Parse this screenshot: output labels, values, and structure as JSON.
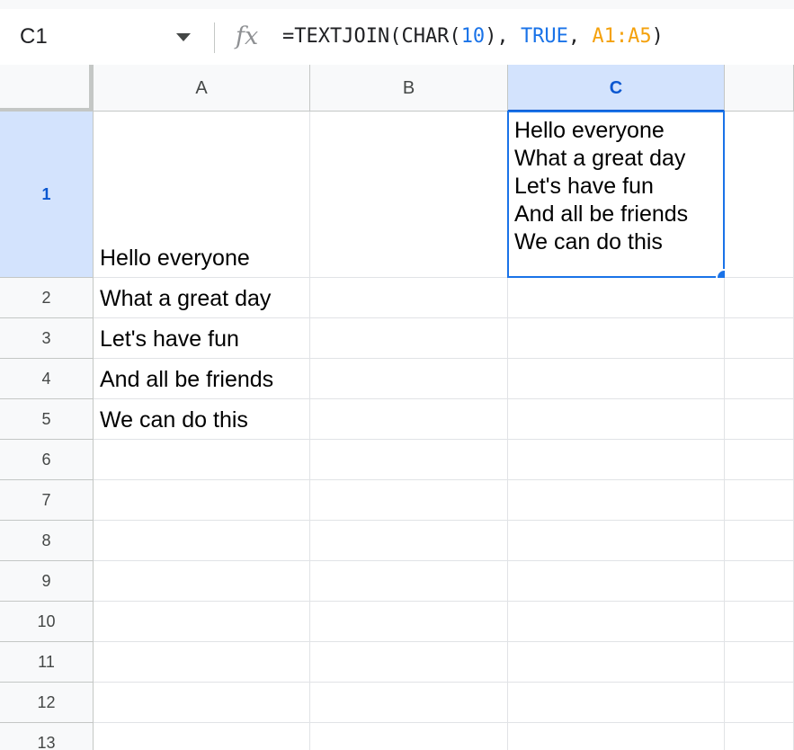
{
  "formula_bar": {
    "name_box": "C1",
    "fx_label": "fx",
    "formula_parts": {
      "fn": "=TEXTJOIN(CHAR(",
      "num": "10",
      "sep1": "), ",
      "bool": "TRUE",
      "sep2": ", ",
      "ref": "A1:A5",
      "end": ")"
    }
  },
  "columns": [
    "A",
    "B",
    "C"
  ],
  "selected_column": "C",
  "rows": [
    {
      "label": "1",
      "A": "Hello everyone",
      "B": "",
      "C": "Hello everyone\nWhat a great day\nLet's have fun\nAnd all be friends\nWe can do this"
    },
    {
      "label": "2",
      "A": "What a great day",
      "B": "",
      "C": ""
    },
    {
      "label": "3",
      "A": "Let's have fun",
      "B": "",
      "C": ""
    },
    {
      "label": "4",
      "A": "And all be friends",
      "B": "",
      "C": ""
    },
    {
      "label": "5",
      "A": "We can do this",
      "B": "",
      "C": ""
    },
    {
      "label": "6",
      "A": "",
      "B": "",
      "C": ""
    },
    {
      "label": "7",
      "A": "",
      "B": "",
      "C": ""
    },
    {
      "label": "8",
      "A": "",
      "B": "",
      "C": ""
    },
    {
      "label": "9",
      "A": "",
      "B": "",
      "C": ""
    },
    {
      "label": "10",
      "A": "",
      "B": "",
      "C": ""
    },
    {
      "label": "11",
      "A": "",
      "B": "",
      "C": ""
    },
    {
      "label": "12",
      "A": "",
      "B": "",
      "C": ""
    },
    {
      "label": "13",
      "A": "",
      "B": "",
      "C": ""
    }
  ],
  "selected_cell": "C1",
  "colors": {
    "selection": "#1a73e8",
    "header_selected_bg": "#d3e3fd",
    "reference_color": "#f4a10c"
  }
}
